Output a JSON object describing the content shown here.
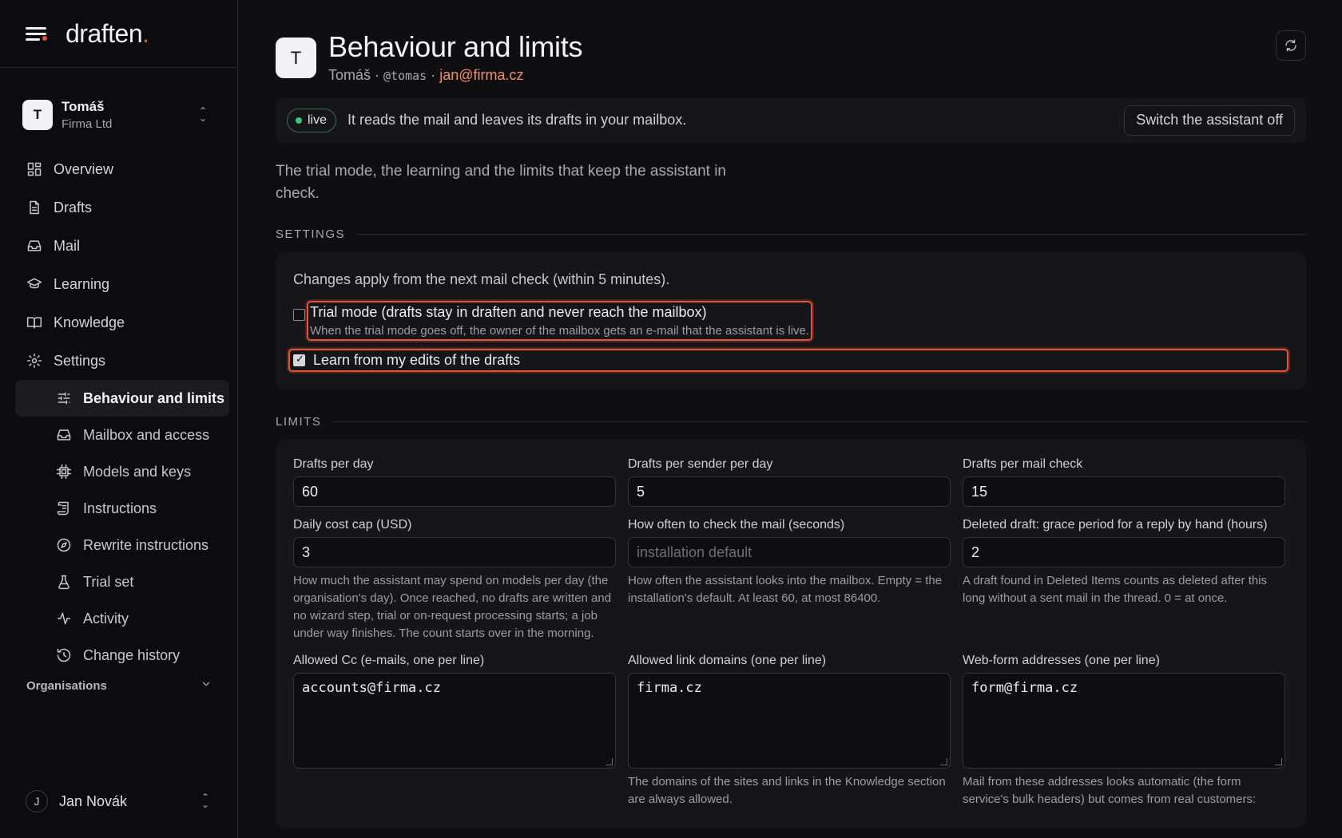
{
  "app": {
    "logo": "draften",
    "logo_dot": "."
  },
  "account": {
    "initial": "T",
    "name": "Tomáš",
    "org": "Firma Ltd"
  },
  "nav": {
    "items": [
      {
        "label": "Overview",
        "icon": "grid-icon"
      },
      {
        "label": "Drafts",
        "icon": "document-icon"
      },
      {
        "label": "Mail",
        "icon": "inbox-icon"
      },
      {
        "label": "Learning",
        "icon": "graduation-cap-icon"
      },
      {
        "label": "Knowledge",
        "icon": "book-icon"
      },
      {
        "label": "Settings",
        "icon": "gear-icon"
      }
    ],
    "settings_items": [
      {
        "label": "Behaviour and limits",
        "icon": "sliders-icon",
        "active": true
      },
      {
        "label": "Mailbox and access",
        "icon": "inbox-icon"
      },
      {
        "label": "Models and keys",
        "icon": "chip-icon"
      },
      {
        "label": "Instructions",
        "icon": "scroll-icon"
      },
      {
        "label": "Rewrite instructions",
        "icon": "compass-icon"
      },
      {
        "label": "Trial set",
        "icon": "flask-icon"
      },
      {
        "label": "Activity",
        "icon": "activity-icon"
      },
      {
        "label": "Change history",
        "icon": "history-icon"
      }
    ],
    "organisations_label": "Organisations"
  },
  "user": {
    "initial": "J",
    "name": "Jan Novák"
  },
  "page": {
    "avatar_initial": "T",
    "title": "Behaviour and limits",
    "sub_name": "Tomáš ·",
    "sub_handle": "@tomas",
    "sub_sep": "·",
    "sub_email": "jan@firma.cz"
  },
  "status": {
    "badge": "live",
    "text": "It reads the mail and leaves its drafts in your mailbox.",
    "switch_off_label": "Switch the assistant off"
  },
  "intro": "The trial mode, the learning and the limits that keep the assistant in check.",
  "settings": {
    "section_label": "SETTINGS",
    "note": "Changes apply from the next mail check (within 5 minutes).",
    "trial_mode": {
      "label": "Trial mode (drafts stay in draften and never reach the mailbox)",
      "help": "When the trial mode goes off, the owner of the mailbox gets an e-mail that the assistant is live.",
      "checked": false
    },
    "learn_edits": {
      "label": "Learn from my edits of the drafts",
      "checked": true
    }
  },
  "limits": {
    "section_label": "LIMITS",
    "drafts_per_day": {
      "label": "Drafts per day",
      "value": "60"
    },
    "drafts_per_sender": {
      "label": "Drafts per sender per day",
      "value": "5"
    },
    "drafts_per_check": {
      "label": "Drafts per mail check",
      "value": "15"
    },
    "daily_cost_cap": {
      "label": "Daily cost cap (USD)",
      "value": "3",
      "help": "How much the assistant may spend on models per day (the organisation's day). Once reached, no drafts are written and no wizard step, trial or on-request processing starts; a job under way finishes. The count starts over in the morning."
    },
    "check_interval": {
      "label": "How often to check the mail (seconds)",
      "value": "",
      "placeholder": "installation default",
      "help": "How often the assistant looks into the mailbox. Empty = the installation's default. At least 60, at most 86400."
    },
    "grace_period": {
      "label": "Deleted draft: grace period for a reply by hand (hours)",
      "value": "2",
      "help": "A draft found in Deleted Items counts as deleted after this long without a sent mail in the thread. 0 = at once."
    },
    "allowed_cc": {
      "label": "Allowed Cc (e-mails, one per line)",
      "value": "accounts@firma.cz"
    },
    "allowed_domains": {
      "label": "Allowed link domains (one per line)",
      "value": "firma.cz",
      "help": "The domains of the sites and links in the Knowledge section are always allowed."
    },
    "webform_addresses": {
      "label": "Web-form addresses (one per line)",
      "value": "form@firma.cz",
      "help": "Mail from these addresses looks automatic (the form service's bulk headers) but comes from real customers:"
    }
  },
  "colors": {
    "accent": "#e5533d",
    "live": "#3fc27d",
    "email": "#ef8f6e",
    "bg": "#0f0f11",
    "card": "#161618"
  }
}
